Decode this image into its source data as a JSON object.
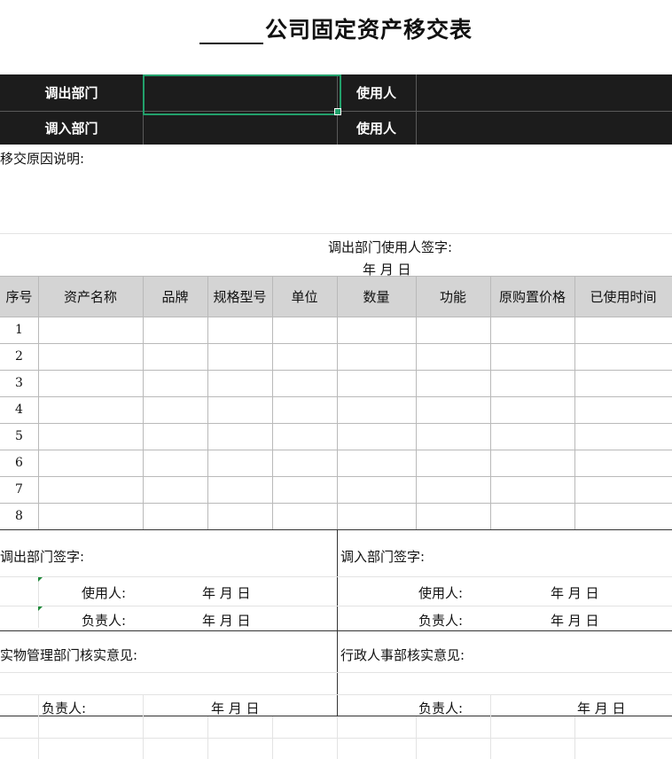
{
  "title": "公司固定资产移交表",
  "header_rows": [
    {
      "label": "调出部门",
      "user_label": "使用人"
    },
    {
      "label": "调入部门",
      "user_label": "使用人"
    }
  ],
  "reason_label": "移交原因说明:",
  "out_user_sign": "调出部门使用人签字:",
  "date_text": "年   月   日",
  "columns": [
    "序号",
    "资产名称",
    "品牌",
    "规格型号",
    "单位",
    "数量",
    "功能",
    "原购置价格",
    "已使用时间"
  ],
  "rows": [
    "1",
    "2",
    "3",
    "4",
    "5",
    "6",
    "7",
    "8"
  ],
  "out_dept_sign": "调出部门签字:",
  "in_dept_sign": "调入部门签字:",
  "user_label": "使用人:",
  "owner_label": "负责人:",
  "date_short": "年  月   日",
  "asset_mgmt_opinion": "实物管理部门核实意见:",
  "hr_opinion": "行政人事部核实意见:",
  "colors": {
    "header_dark": "#1c1c1c",
    "table_header": "#d4d4d4",
    "selection": "#22a06b"
  }
}
